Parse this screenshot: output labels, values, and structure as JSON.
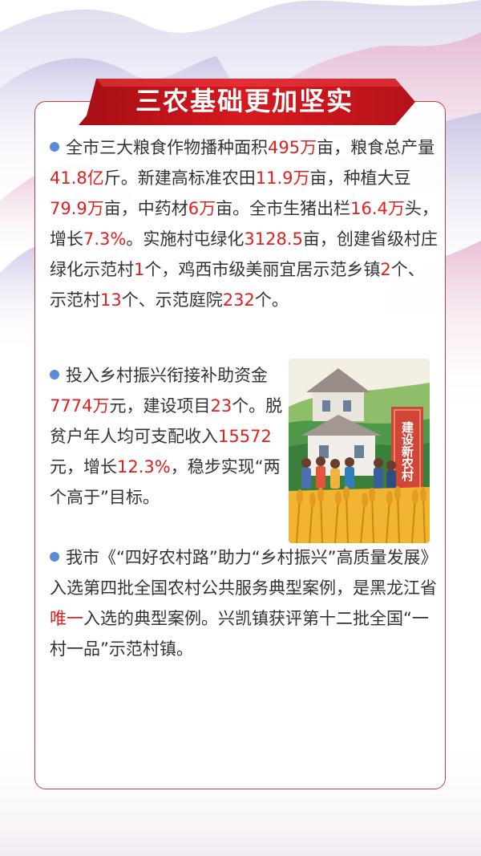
{
  "header": {
    "title": "三农基础更加坚实"
  },
  "paragraphs": [
    {
      "segments": [
        {
          "text": "全市三大粮食作物播种面积",
          "hl": false
        },
        {
          "text": "495万",
          "hl": true
        },
        {
          "text": "亩，粮食总产量",
          "hl": false
        },
        {
          "text": "41.8亿",
          "hl": true
        },
        {
          "text": "斤。新建高标准农田",
          "hl": false
        },
        {
          "text": "11.9万",
          "hl": true
        },
        {
          "text": "亩，种植大豆",
          "hl": false
        },
        {
          "text": "79.9万",
          "hl": true
        },
        {
          "text": "亩，中药材",
          "hl": false
        },
        {
          "text": "6万",
          "hl": true
        },
        {
          "text": "亩。全市生猪出栏",
          "hl": false
        },
        {
          "text": "16.4万",
          "hl": true
        },
        {
          "text": "头，增长",
          "hl": false
        },
        {
          "text": "7.3%",
          "hl": true
        },
        {
          "text": "。实施村屯绿化",
          "hl": false
        },
        {
          "text": "3128.5",
          "hl": true
        },
        {
          "text": "亩，创建省级村庄绿化示范村",
          "hl": false
        },
        {
          "text": "1",
          "hl": true
        },
        {
          "text": "个，鸡西市级美丽宜居示范乡镇",
          "hl": false
        },
        {
          "text": "2",
          "hl": true
        },
        {
          "text": "个、示范村",
          "hl": false
        },
        {
          "text": "13",
          "hl": true
        },
        {
          "text": "个、示范庭院",
          "hl": false
        },
        {
          "text": "232",
          "hl": true
        },
        {
          "text": "个。",
          "hl": false
        }
      ]
    },
    {
      "segments": [
        {
          "text": "投入乡村振兴衔接补助资金",
          "hl": false
        },
        {
          "text": "7774万",
          "hl": true
        },
        {
          "text": "元，建设项目",
          "hl": false
        },
        {
          "text": "23",
          "hl": true
        },
        {
          "text": "个。脱贫户年人均可支配收入",
          "hl": false
        },
        {
          "text": "15572",
          "hl": true
        },
        {
          "text": "元，增长",
          "hl": false
        },
        {
          "text": "12.3%",
          "hl": true
        },
        {
          "text": "，稳步实现“两个高于”目标。",
          "hl": false
        }
      ]
    },
    {
      "segments": [
        {
          "text": "我市《“四好农村路”助力“乡村振兴”高质量发展》入选第四批全国农村公共服务典型案例，是黑龙江省",
          "hl": false
        },
        {
          "text": "唯一",
          "hl": true
        },
        {
          "text": "入选的典型案例。兴凯镇获评第十二批全国“一村一品”示范村镇。",
          "hl": false
        }
      ]
    }
  ],
  "illustration": {
    "sign_text": "建设新农村"
  },
  "colors": {
    "accent_red": "#e01f1f",
    "bullet_blue": "#5b8ad8",
    "banner_red": "#c8161d"
  }
}
